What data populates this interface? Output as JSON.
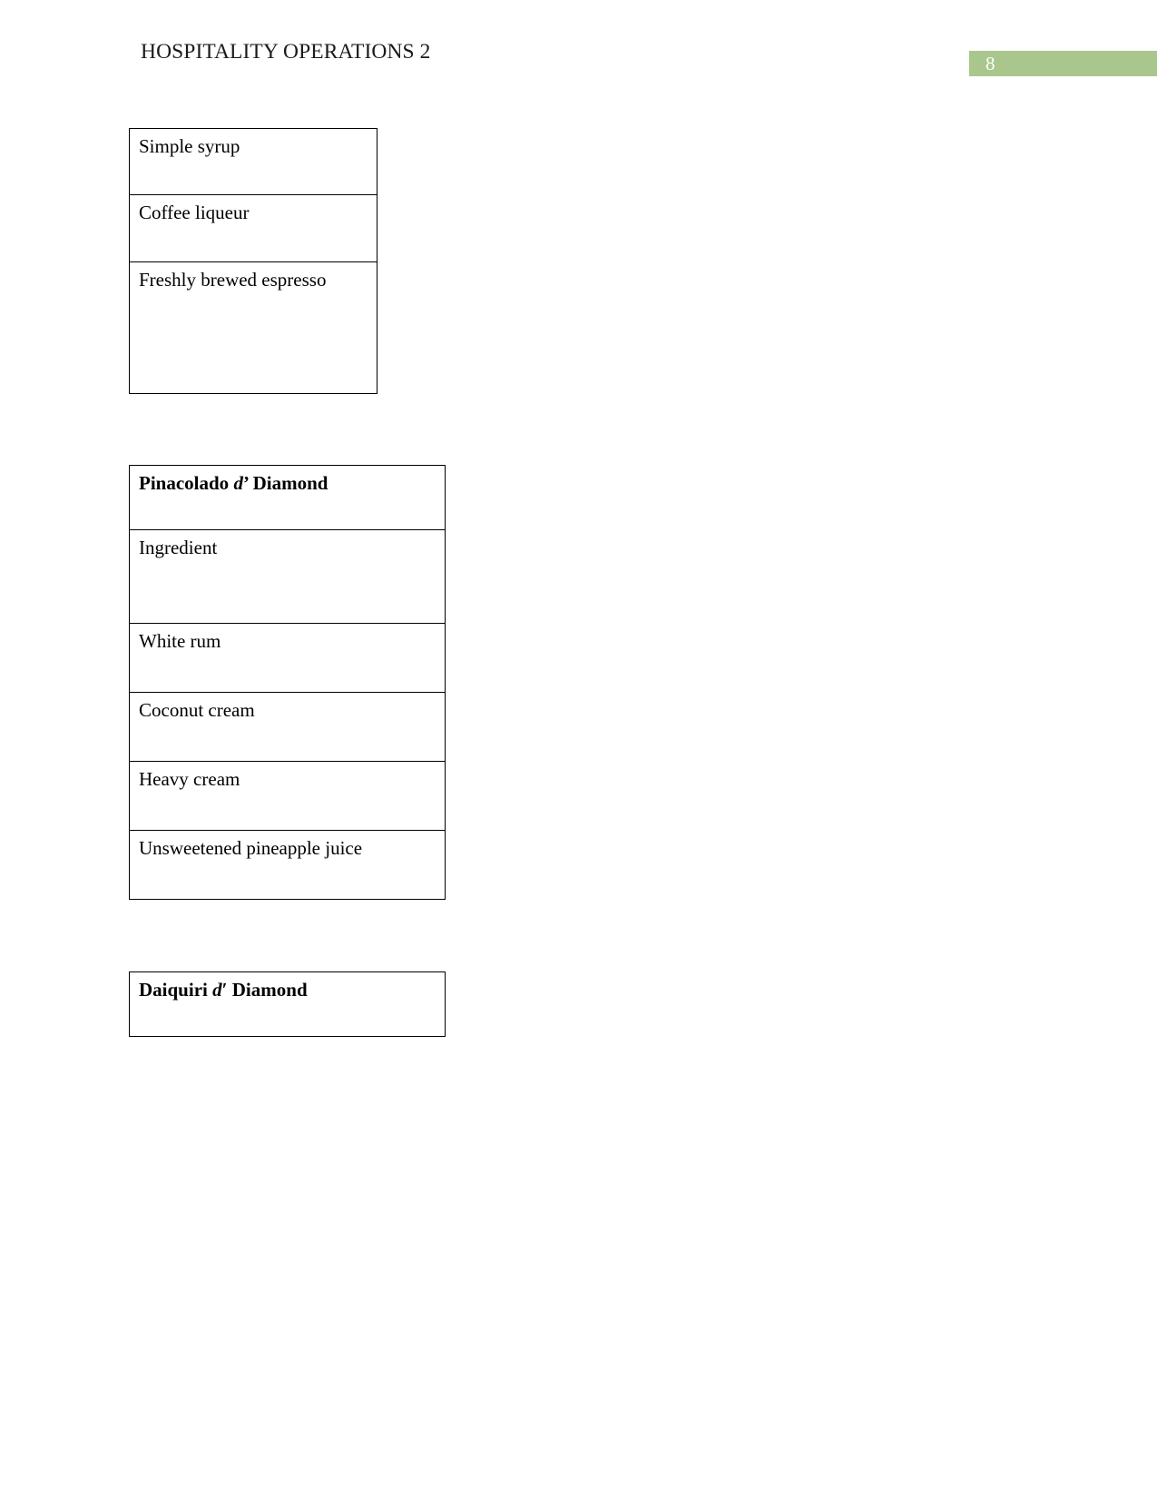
{
  "header": {
    "title": "HOSPITALITY OPERATIONS 2",
    "page_number": "8",
    "page_number_bg": "#A9C68C",
    "page_number_color": "#FFFFFF"
  },
  "tables": {
    "espresso_continuation": {
      "rows": [
        {
          "text": "Simple syrup"
        },
        {
          "text": "Coffee liqueur"
        },
        {
          "text": "Freshly brewed espresso"
        }
      ]
    },
    "pinacolado": {
      "title_prefix": "Pinacolado ",
      "title_italic": "d",
      "title_suffix": "’ Diamond",
      "column_header": "Ingredient",
      "rows": [
        {
          "text": "White rum"
        },
        {
          "text": "Coconut cream"
        },
        {
          "text": "Heavy cream"
        },
        {
          "text": "Unsweetened pineapple juice"
        }
      ]
    },
    "daiquiri": {
      "title_prefix": "Daiquiri ",
      "title_italic": "d",
      "title_suffix": "′ Diamond"
    }
  }
}
